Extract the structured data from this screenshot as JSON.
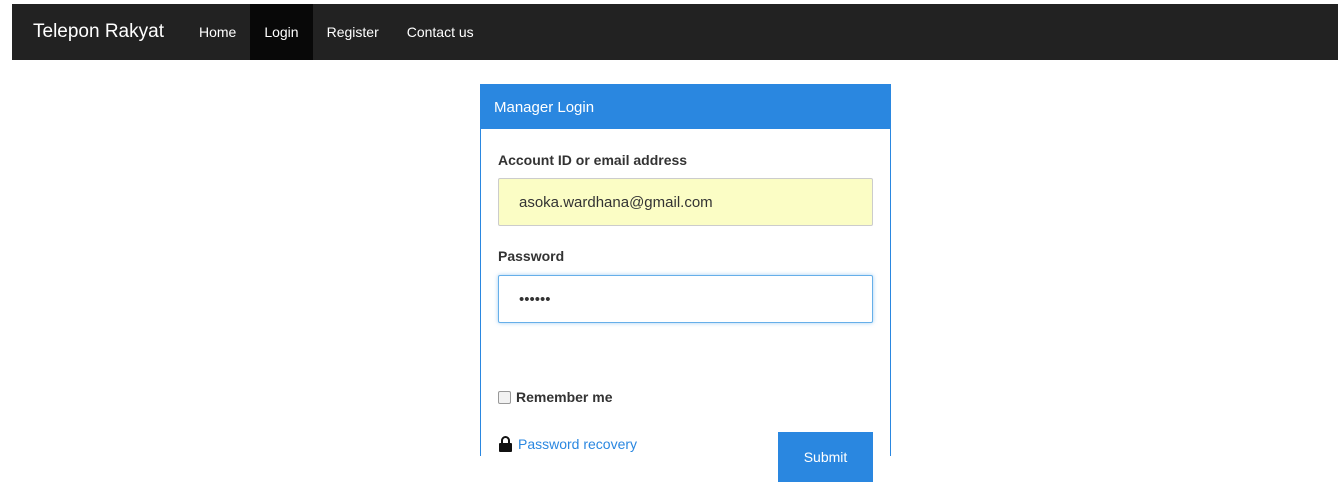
{
  "navbar": {
    "brand": "Telepon Rakyat",
    "items": [
      {
        "label": "Home"
      },
      {
        "label": "Login",
        "active": true
      },
      {
        "label": "Register"
      },
      {
        "label": "Contact us"
      }
    ]
  },
  "login_panel": {
    "title": "Manager Login",
    "account_label": "Account ID or email address",
    "account_value": "asoka.wardhana@gmail.com",
    "password_label": "Password",
    "password_value": "••••••",
    "remember_label": "Remember me",
    "remember_checked": false,
    "recovery_icon": "lock-icon",
    "recovery_label": "Password recovery",
    "submit_label": "Submit"
  },
  "colors": {
    "navbar_bg": "#222222",
    "accent": "#2a87e0",
    "autofill_bg": "#fbfdc5"
  }
}
